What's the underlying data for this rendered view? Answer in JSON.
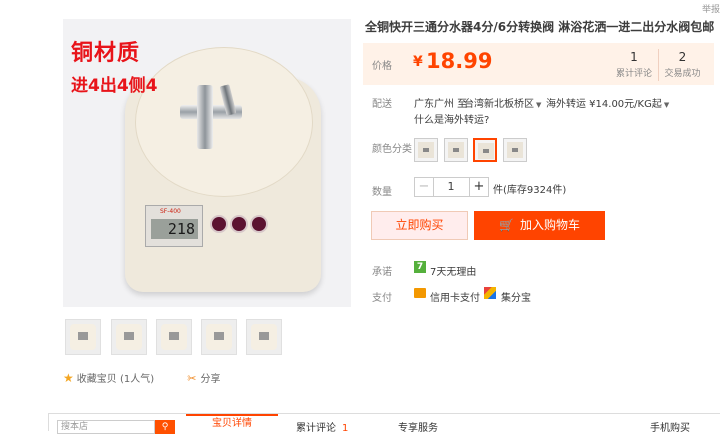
{
  "report": "举报",
  "product": {
    "image_overlay_line1": "铜材质",
    "image_overlay_line2": "进4出4侧4",
    "scale_brand": "SF-400",
    "scale_display": "218",
    "title": "全铜快开三通分水器4分/6分转换阀 淋浴花洒一进二出分水阀包邮",
    "price_label": "价格",
    "price_symbol": "¥",
    "price": "18.99",
    "stats": [
      {
        "value": "1",
        "label": "累计评论"
      },
      {
        "value": "2",
        "label": "交易成功"
      }
    ]
  },
  "delivery": {
    "label": "配送",
    "from": "广东广州 至",
    "to": "台湾新北板桥区",
    "shipping": "海外转运 ¥14.00元/KG起",
    "help": "什么是海外转运?"
  },
  "color": {
    "label": "颜色分类",
    "selected_index": 2
  },
  "quantity": {
    "label": "数量",
    "minus": "−",
    "value": "1",
    "plus": "+",
    "stock": "件(库存9324件)"
  },
  "buttons": {
    "buy_now": "立即购买",
    "add_cart": "加入购物车"
  },
  "promise": {
    "label": "承诺",
    "badge": "7",
    "text": "7天无理由"
  },
  "payment": {
    "label": "支付",
    "card": "信用卡支付",
    "jifen": "集分宝"
  },
  "actions": {
    "favorite": "收藏宝贝 (1人气)",
    "share": "分享"
  },
  "bottom": {
    "search_placeholder": "搜本店",
    "tab_detail": "宝贝详情",
    "tab_reviews": "累计评论",
    "tab_reviews_count": "1",
    "tab_service": "专享服务",
    "tab_mobile": "手机购买"
  },
  "icons": {
    "star": "star-icon",
    "share": "scissors-icon",
    "cart": "cart-icon",
    "search": "search-icon"
  },
  "colors": {
    "accent": "#ff4400",
    "price": "#ff4400",
    "price_bg": "#fff2e8"
  }
}
